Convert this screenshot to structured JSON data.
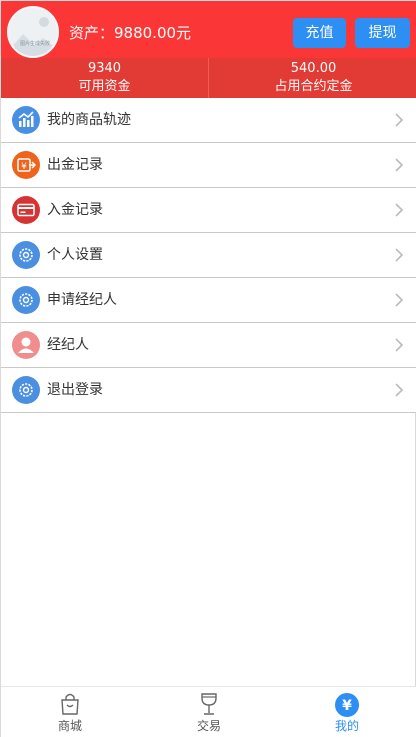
{
  "header": {
    "avatar_caption": "图片生成失败",
    "asset_text": "资产：9880.00元",
    "recharge_label": "充值",
    "withdraw_label": "提现"
  },
  "stats": {
    "available": {
      "value": "9340",
      "label": "可用资金"
    },
    "deposit": {
      "value": "540.00",
      "label": "占用合约定金"
    }
  },
  "menu": {
    "items": [
      {
        "label": "我的商品轨迹",
        "icon": "chart-trend-icon",
        "color": "#4a90e2"
      },
      {
        "label": "出金记录",
        "icon": "yuan-out-icon",
        "color": "#f0631c"
      },
      {
        "label": "入金记录",
        "icon": "card-icon",
        "color": "#d63434"
      },
      {
        "label": "个人设置",
        "icon": "gear-icon",
        "color": "#4a8fe0"
      },
      {
        "label": "申请经纪人",
        "icon": "gear-icon",
        "color": "#4a8fe0"
      },
      {
        "label": "经纪人",
        "icon": "person-icon",
        "color": "#f08d8d"
      },
      {
        "label": "退出登录",
        "icon": "gear-icon",
        "color": "#4a8fe0"
      }
    ]
  },
  "tabbar": {
    "shop_label": "商城",
    "trade_label": "交易",
    "mine_label": "我的",
    "mine_glyph": "¥",
    "active_color": "#2d8ef4"
  },
  "colors": {
    "header_red": "#fb3636",
    "stats_red": "#e23a34",
    "button_blue": "#2d8ef4"
  }
}
